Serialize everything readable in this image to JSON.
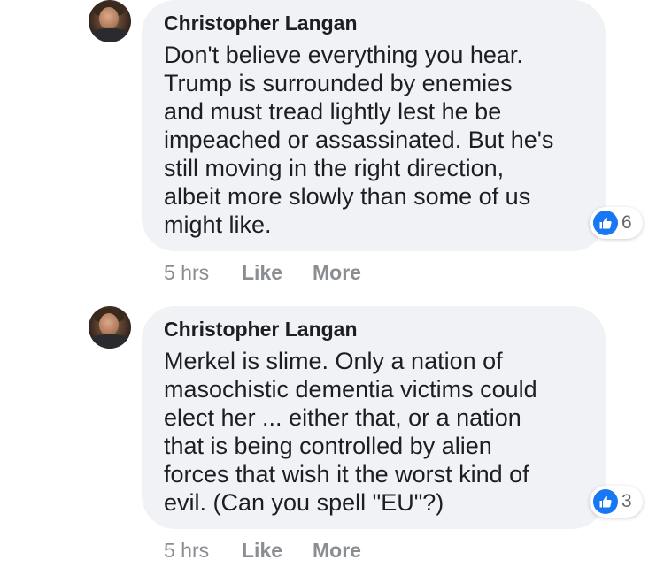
{
  "comments": [
    {
      "author": "Christopher Langan",
      "text": "Don't believe everything you hear.\nTrump is surrounded by enemies\nand must tread lightly lest he be\nimpeached or assassinated. But he's\nstill moving in the right direction,\nalbeit more slowly than some of us\nmight like.",
      "reactions": {
        "icon": "thumbs-up-icon",
        "count": "6"
      },
      "timestamp": "5 hrs",
      "like_label": "Like",
      "more_label": "More"
    },
    {
      "author": "Christopher Langan",
      "text": "Merkel is slime. Only a nation of\nmasochistic dementia victims could\nelect her ... either that, or a nation\nthat is being controlled by alien\nforces that wish it the worst kind of\nevil. (Can you spell \"EU\"?)",
      "reactions": {
        "icon": "thumbs-up-icon",
        "count": "3"
      },
      "timestamp": "5 hrs",
      "like_label": "Like",
      "more_label": "More"
    }
  ],
  "colors": {
    "bubble_bg": "#f0f2f5",
    "like_blue": "#1877f2",
    "meta_gray": "#8a8d91"
  }
}
